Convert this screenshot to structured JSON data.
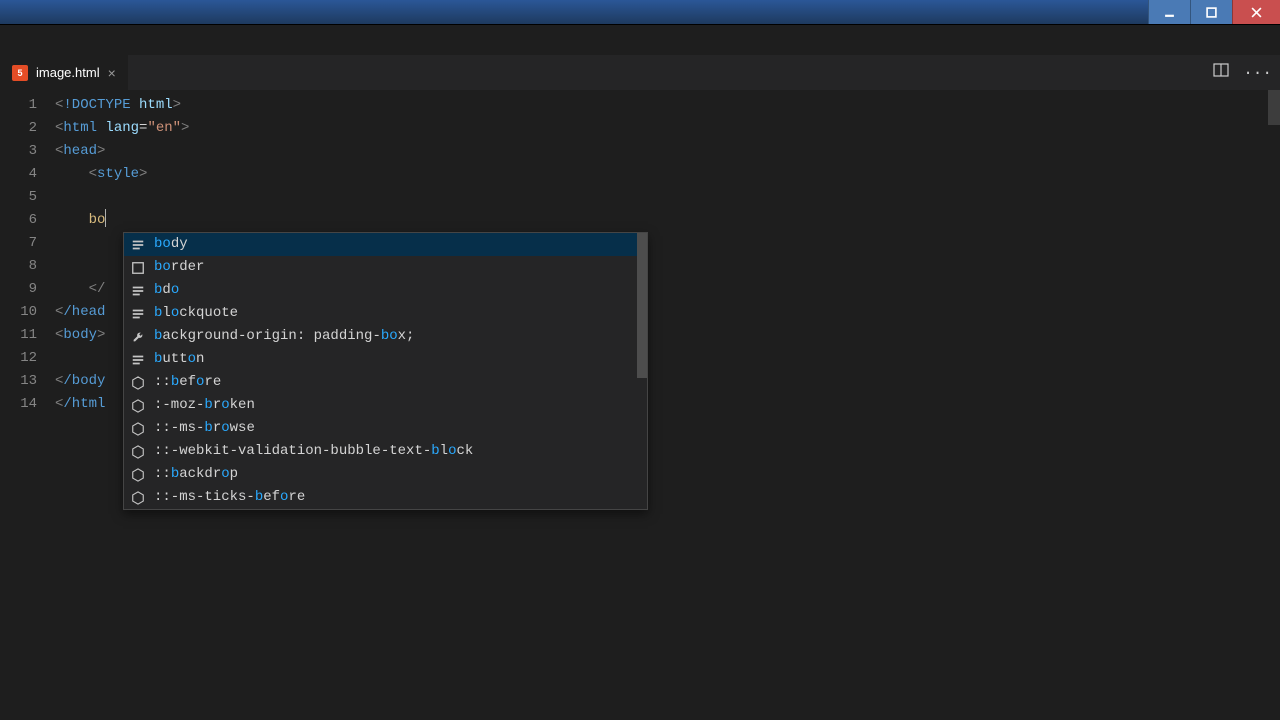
{
  "window": {
    "min_title": "Minimize",
    "max_title": "Maximize",
    "close_title": "Close"
  },
  "tab": {
    "filename": "image.html",
    "icon_letter": "5"
  },
  "gutter": [
    "1",
    "2",
    "3",
    "4",
    "5",
    "6",
    "7",
    "8",
    "9",
    "10",
    "11",
    "12",
    "13",
    "14"
  ],
  "code": {
    "l1_doctype": "!DOCTYPE",
    "l1_html": " html",
    "l2_html": "html",
    "l2_lang": " lang",
    "l2_eq": "=",
    "l2_val": "\"en\"",
    "l3_head": "head",
    "l4_indent": "    ",
    "l4_style": "style",
    "l6_indent": "    ",
    "l6_typed": "bo",
    "l9_indent": "    ",
    "l9_close_style": "/",
    "l10_close_head": "/head",
    "l11_body": "body",
    "l13_close_body": "/body",
    "l14_close_html": "/html"
  },
  "autocomplete": {
    "items": [
      {
        "icon": "snippet",
        "segments": [
          {
            "t": "bo",
            "m": true
          },
          {
            "t": "dy",
            "m": false
          }
        ],
        "selected": true
      },
      {
        "icon": "box",
        "segments": [
          {
            "t": "bo",
            "m": true
          },
          {
            "t": "rder",
            "m": false
          }
        ]
      },
      {
        "icon": "snippet",
        "segments": [
          {
            "t": "b",
            "m": true
          },
          {
            "t": "d",
            "m": false
          },
          {
            "t": "o",
            "m": true
          }
        ]
      },
      {
        "icon": "snippet",
        "segments": [
          {
            "t": "b",
            "m": true
          },
          {
            "t": "l",
            "m": false
          },
          {
            "t": "o",
            "m": true
          },
          {
            "t": "ckquote",
            "m": false
          }
        ]
      },
      {
        "icon": "wrench",
        "segments": [
          {
            "t": "b",
            "m": true
          },
          {
            "t": "ackground-origin: padding-",
            "m": false
          },
          {
            "t": "bo",
            "m": true
          },
          {
            "t": "x;",
            "m": false
          }
        ]
      },
      {
        "icon": "snippet",
        "segments": [
          {
            "t": "b",
            "m": true
          },
          {
            "t": "utt",
            "m": false
          },
          {
            "t": "o",
            "m": true
          },
          {
            "t": "n",
            "m": false
          }
        ]
      },
      {
        "icon": "hex",
        "segments": [
          {
            "t": "::",
            "m": false
          },
          {
            "t": "b",
            "m": true
          },
          {
            "t": "ef",
            "m": false
          },
          {
            "t": "o",
            "m": true
          },
          {
            "t": "re",
            "m": false
          }
        ]
      },
      {
        "icon": "hex",
        "segments": [
          {
            "t": ":-moz-",
            "m": false
          },
          {
            "t": "b",
            "m": true
          },
          {
            "t": "r",
            "m": false
          },
          {
            "t": "o",
            "m": true
          },
          {
            "t": "ken",
            "m": false
          }
        ]
      },
      {
        "icon": "hex",
        "segments": [
          {
            "t": "::-ms-",
            "m": false
          },
          {
            "t": "b",
            "m": true
          },
          {
            "t": "r",
            "m": false
          },
          {
            "t": "o",
            "m": true
          },
          {
            "t": "wse",
            "m": false
          }
        ]
      },
      {
        "icon": "hex",
        "segments": [
          {
            "t": "::-webkit-validation-bubble-text-",
            "m": false
          },
          {
            "t": "b",
            "m": true
          },
          {
            "t": "l",
            "m": false
          },
          {
            "t": "o",
            "m": true
          },
          {
            "t": "ck",
            "m": false
          }
        ]
      },
      {
        "icon": "hex",
        "segments": [
          {
            "t": "::",
            "m": false
          },
          {
            "t": "b",
            "m": true
          },
          {
            "t": "ackdr",
            "m": false
          },
          {
            "t": "o",
            "m": true
          },
          {
            "t": "p",
            "m": false
          }
        ]
      },
      {
        "icon": "hex",
        "segments": [
          {
            "t": "::-ms-ticks-",
            "m": false
          },
          {
            "t": "b",
            "m": true
          },
          {
            "t": "ef",
            "m": false
          },
          {
            "t": "o",
            "m": true
          },
          {
            "t": "re",
            "m": false
          }
        ]
      }
    ]
  }
}
